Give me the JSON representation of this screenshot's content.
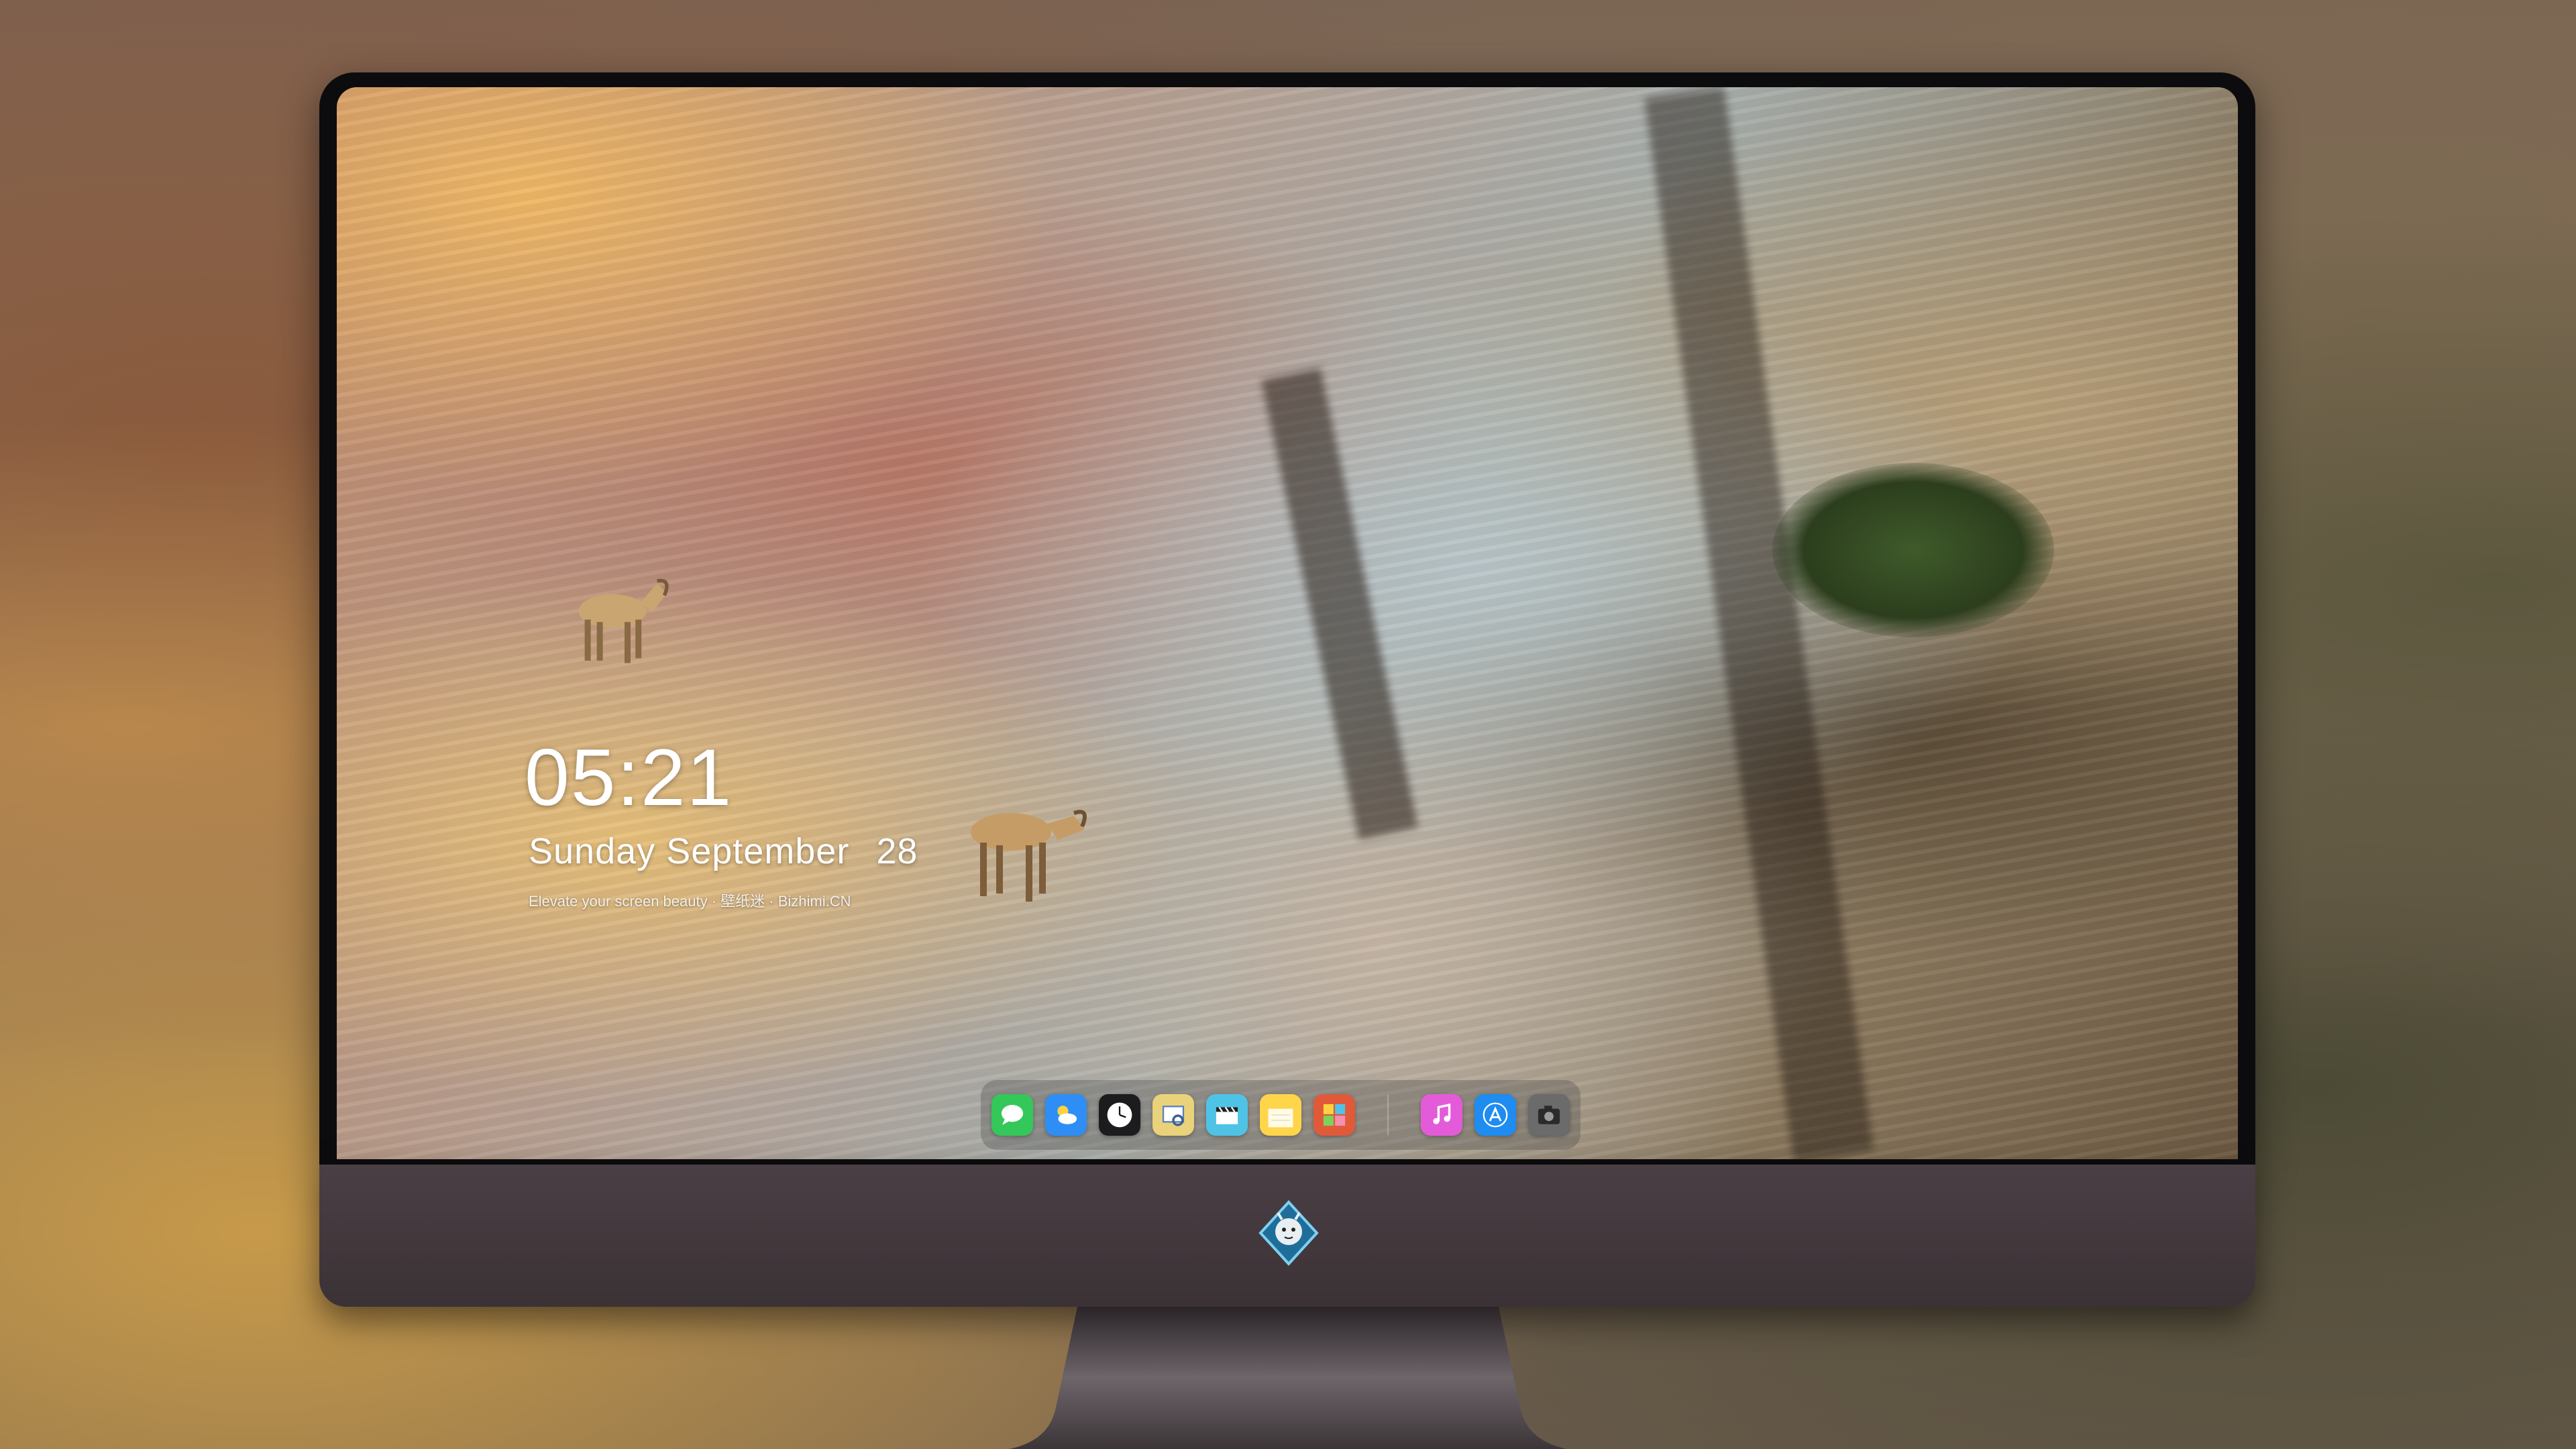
{
  "lockscreen": {
    "time": "05:21",
    "weekday": "Sunday",
    "month": "September",
    "day": "28",
    "caption": "Elevate your screen beauty · 壁纸迷 · Bizhimi.CN"
  },
  "dock": {
    "apps": [
      {
        "name": "Messages",
        "icon": "messages-icon",
        "color": "#34c759"
      },
      {
        "name": "Weather",
        "icon": "weather-icon",
        "color": "#2f8ef5"
      },
      {
        "name": "Clock",
        "icon": "clock-icon",
        "color": "#1c1c1e"
      },
      {
        "name": "Preview",
        "icon": "preview-icon",
        "color": "#e9d27a"
      },
      {
        "name": "Clips",
        "icon": "clips-icon",
        "color": "#4fc3e6"
      },
      {
        "name": "Notes",
        "icon": "notes-icon",
        "color": "#ffd54a"
      },
      {
        "name": "Photo Booth",
        "icon": "photobooth-icon",
        "color": "#e05a3a"
      },
      {
        "name": "iTunes",
        "icon": "music-icon",
        "color": "#e35bd8"
      },
      {
        "name": "App Store",
        "icon": "appstore-icon",
        "color": "#1e8cf0"
      },
      {
        "name": "Camera",
        "icon": "camera-icon",
        "color": "#6b6b6b"
      }
    ]
  },
  "monitor": {
    "logo": "dragon-logo-icon"
  }
}
